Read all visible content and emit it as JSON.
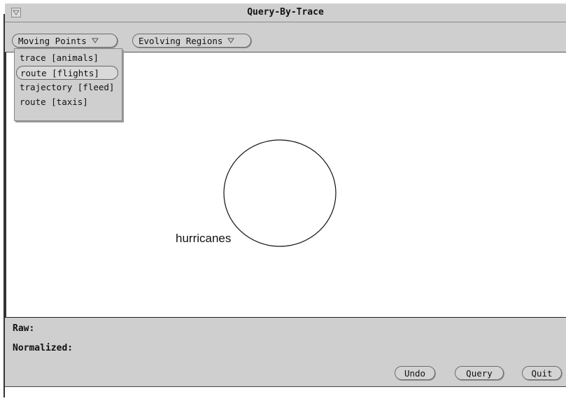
{
  "window": {
    "title": "Query-By-Trace"
  },
  "toolbar": {
    "moving_points_label": "Moving Points",
    "evolving_regions_label": "Evolving Regions"
  },
  "menu": {
    "items": [
      {
        "label": "trace [animals]",
        "selected": false
      },
      {
        "label": "route [flights]",
        "selected": true
      },
      {
        "label": "trajectory [fleed]",
        "selected": false
      },
      {
        "label": "route [taxis]",
        "selected": false
      }
    ]
  },
  "canvas": {
    "shape": "circle",
    "shape_label": "hurricanes"
  },
  "panel": {
    "raw_label": "Raw:",
    "normalized_label": "Normalized:",
    "undo_label": "Undo",
    "query_label": "Query",
    "quit_label": "Quit"
  },
  "colors": {
    "panel_bg": "#cfcfcf",
    "canvas_bg": "#ffffff",
    "border": "#333333"
  }
}
